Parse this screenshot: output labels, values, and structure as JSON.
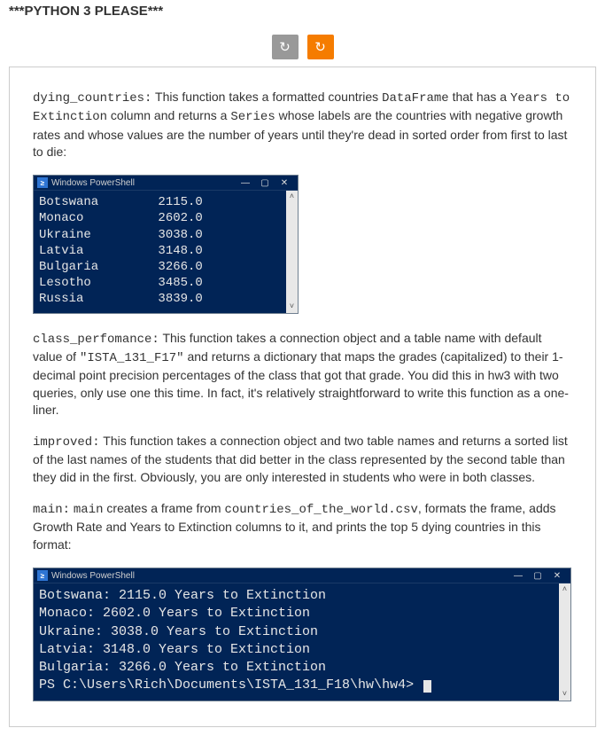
{
  "header": {
    "title": "***PYTHON 3 PLEASE***"
  },
  "toolbar": {
    "reload_icon": "↻",
    "refresh_icon": "↻"
  },
  "para1": {
    "fn": "dying_countries:",
    "t1": " This function takes a formatted countries ",
    "c1": "DataFrame",
    "t2": " that has a ",
    "c2": "Years to Extinction",
    "t3": " column and returns a ",
    "c3": "Series",
    "t4": " whose labels are the countries with negative growth rates and whose values are the number of years until they're dead in sorted order from first to last to die:"
  },
  "ps1": {
    "title": "Windows PowerShell",
    "rows": [
      {
        "country": "Botswana",
        "value": "2115.0"
      },
      {
        "country": "Monaco",
        "value": "2602.0"
      },
      {
        "country": "Ukraine",
        "value": "3038.0"
      },
      {
        "country": "Latvia",
        "value": "3148.0"
      },
      {
        "country": "Bulgaria",
        "value": "3266.0"
      },
      {
        "country": "Lesotho",
        "value": "3485.0"
      },
      {
        "country": "Russia",
        "value": "3839.0"
      }
    ]
  },
  "para2": {
    "fn": "class_perfomance:",
    "t1": " This function takes a connection object and a table name with default value of ",
    "c1": "\"ISTA_131_F17\"",
    "t2": " and returns a dictionary that maps the grades (capitalized) to their 1-decimal point precision percentages of the class that got that grade.  You did this in hw3 with two queries, only use one this time.  In fact, it's relatively straightforward to write this function as a one-liner."
  },
  "para3": {
    "fn": "improved:",
    "t1": " This function takes a connection object and two table names and returns a sorted list of the last names of the students that did better in the class represented by the second table than they did in the first.  Obviously, you are only interested in students who were in both classes."
  },
  "para4": {
    "fn": "main:",
    "t1": " ",
    "c1": "main",
    "t2": " creates a frame from ",
    "c2": "countries_of_the_world.csv",
    "t3": ", formats the frame, adds Growth Rate and Years to Extinction columns to it, and prints the top 5 dying countries in this format:"
  },
  "ps2": {
    "title": "Windows PowerShell",
    "lines": [
      "Botswana: 2115.0 Years to Extinction",
      "Monaco: 2602.0 Years to Extinction",
      "Ukraine: 3038.0 Years to Extinction",
      "Latvia: 3148.0 Years to Extinction",
      "Bulgaria: 3266.0 Years to Extinction"
    ],
    "prompt": "PS C:\\Users\\Rich\\Documents\\ISTA_131_F18\\hw\\hw4> "
  },
  "winbtns": {
    "min": "—",
    "max": "▢",
    "close": "✕"
  },
  "scroll": {
    "up": "˄",
    "down": "˅"
  }
}
